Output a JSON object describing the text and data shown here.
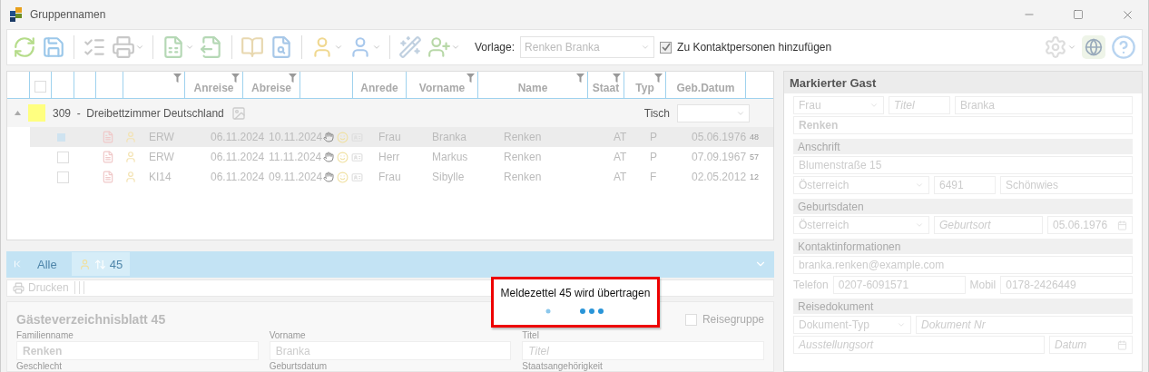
{
  "window": {
    "title": "Gruppennamen"
  },
  "toolbar": {
    "template_label": "Vorlage:",
    "template_value": "Renken Branka",
    "contact_checkbox": {
      "label": "Zu Kontaktpersonen hinzufügen",
      "checked": true
    }
  },
  "grid": {
    "columns": [
      {
        "kind": "empty",
        "filter": false
      },
      {
        "kind": "checkbox",
        "checked": false,
        "filter": false
      },
      {
        "kind": "empty",
        "filter": false
      },
      {
        "kind": "empty",
        "filter": false
      },
      {
        "kind": "empty",
        "filter": false
      },
      {
        "kind": "empty",
        "filter": true
      },
      {
        "kind": "text",
        "label": "Anreise",
        "filter": true
      },
      {
        "kind": "text",
        "label": "Abreise",
        "filter": true
      },
      {
        "kind": "empty",
        "filter": false
      },
      {
        "kind": "text",
        "label": "Anrede",
        "filter": false
      },
      {
        "kind": "text",
        "label": "Vorname",
        "filter": true
      },
      {
        "kind": "text",
        "label": "Name",
        "filter": true
      },
      {
        "kind": "text",
        "label": "Staat",
        "filter": true
      },
      {
        "kind": "text",
        "label": "Typ",
        "filter": true
      },
      {
        "kind": "text",
        "label": "Geb.Datum",
        "filter": false
      }
    ],
    "group": {
      "label": "309  -  Dreibettzimmer Deutschland",
      "color": "#ffff80",
      "expanded": true,
      "table_label": "Tisch"
    },
    "rows": [
      {
        "selected": true,
        "checked": true,
        "category": "ERW",
        "arrival": "06.11.2024",
        "departure": "10.11.2024",
        "salutation": "Frau",
        "first_name": "Branka",
        "last_name": "Renken",
        "country": "AT",
        "type": "P",
        "birth_date": "05.06.1976",
        "age": "48"
      },
      {
        "selected": false,
        "checked": false,
        "category": "ERW",
        "arrival": "06.11.2024",
        "departure": "11.11.2024",
        "salutation": "Herr",
        "first_name": "Markus",
        "last_name": "Renken",
        "country": "AT",
        "type": "P",
        "birth_date": "07.09.1967",
        "age": "57"
      },
      {
        "selected": false,
        "checked": false,
        "category": "KI14",
        "arrival": "06.11.2024",
        "departure": "09.11.2024",
        "salutation": "Frau",
        "first_name": "Sibylle",
        "last_name": "Renken",
        "country": "AT",
        "type": "F",
        "birth_date": "02.05.2012",
        "age": "12"
      }
    ]
  },
  "tabs": [
    {
      "label": "Alle",
      "selected": false
    },
    {
      "label": "45",
      "selected": true
    }
  ],
  "print_toolbar": {
    "print_label": "Drucken"
  },
  "form": {
    "title": "Gästeverzeichnisblatt 45",
    "group_trip": {
      "label": "Reisegruppe",
      "checked": false
    },
    "fields": [
      {
        "label": "Familienname",
        "value": "Renken",
        "bold": true
      },
      {
        "label": "Vorname",
        "value": "Branka",
        "bold": false
      },
      {
        "label": "Titel",
        "placeholder": "Titel"
      }
    ],
    "more_labels": [
      "Geschlecht",
      "Geburtsdatum",
      "Staatsangehörigkeit"
    ]
  },
  "right_panel": {
    "title": "Markierter Gast",
    "sections": [
      {
        "rows": [
          [
            {
              "kind": "select",
              "value": "Frau"
            },
            {
              "kind": "input",
              "placeholder": "Titel"
            },
            {
              "kind": "input",
              "value": "Branka"
            }
          ],
          [
            {
              "kind": "input",
              "value": "Renken",
              "bold": true
            }
          ]
        ]
      },
      {
        "heading": "Anschrift",
        "rows": [
          [
            {
              "kind": "input",
              "value": "Blumenstraße 15"
            }
          ],
          [
            {
              "kind": "select",
              "value": "Österreich"
            },
            {
              "kind": "input",
              "value": "6491"
            },
            {
              "kind": "input",
              "value": "Schönwies"
            }
          ]
        ]
      },
      {
        "heading": "Geburtsdaten",
        "rows": [
          [
            {
              "kind": "select",
              "value": "Österreich"
            },
            {
              "kind": "input",
              "placeholder": "Geburtsort"
            },
            {
              "kind": "date",
              "value": "05.06.1976"
            }
          ]
        ]
      },
      {
        "heading": "Kontaktinformationen",
        "rows": [
          [
            {
              "kind": "input",
              "value": "branka.renken@example.com"
            }
          ],
          [
            {
              "kind": "label",
              "value": "Telefon"
            },
            {
              "kind": "input",
              "value": "0207-6091571"
            },
            {
              "kind": "label",
              "value": "Mobil"
            },
            {
              "kind": "input",
              "value": "0178-2426449"
            }
          ]
        ]
      },
      {
        "heading": "Reisedokument",
        "rows": [
          [
            {
              "kind": "select",
              "value": "Dokument-Typ"
            },
            {
              "kind": "input",
              "placeholder": "Dokument Nr"
            }
          ],
          [
            {
              "kind": "input",
              "placeholder": "Ausstellungsort"
            },
            {
              "kind": "date",
              "placeholder": "Datum"
            }
          ]
        ]
      }
    ]
  },
  "overlay": {
    "message": "Meldezettel 45 wird übertragen"
  }
}
